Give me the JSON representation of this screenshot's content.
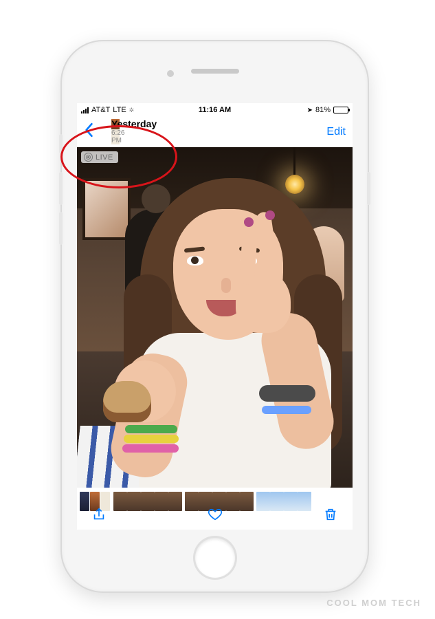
{
  "status_bar": {
    "carrier": "AT&T",
    "network": "LTE",
    "time": "11:16 AM",
    "battery_pct": "81%",
    "location_icon": "◤"
  },
  "nav": {
    "title": "Yesterday",
    "subtitle": "6:26 PM",
    "edit_label": "Edit"
  },
  "live_badge": {
    "label": "LIVE"
  },
  "toolbar": {
    "share": "share-icon",
    "favorite": "heart-icon",
    "delete": "trash-icon"
  },
  "watermark": "COOL MOM TECH"
}
